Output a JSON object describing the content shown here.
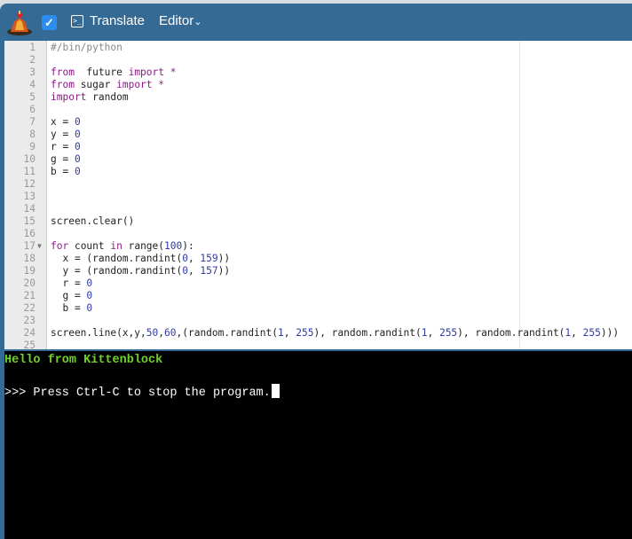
{
  "header": {
    "translate_label": "Translate",
    "editor_label": "Editor",
    "checkbox_checked": true,
    "accent_color": "#356a95"
  },
  "editor": {
    "lines": [
      {
        "n": "1",
        "tokens": [
          [
            "cm",
            "#/bin/python"
          ]
        ]
      },
      {
        "n": "2",
        "tokens": []
      },
      {
        "n": "3",
        "tokens": [
          [
            "kw",
            "from"
          ],
          [
            "",
            "  future "
          ],
          [
            "kw",
            "import"
          ],
          [
            "kw",
            " *"
          ]
        ]
      },
      {
        "n": "4",
        "tokens": [
          [
            "kw",
            "from"
          ],
          [
            "",
            " sugar "
          ],
          [
            "kw",
            "import"
          ],
          [
            "kw",
            " *"
          ]
        ]
      },
      {
        "n": "5",
        "tokens": [
          [
            "kw",
            "import"
          ],
          [
            "",
            " random"
          ]
        ]
      },
      {
        "n": "6",
        "tokens": []
      },
      {
        "n": "7",
        "tokens": [
          [
            "",
            "x = "
          ],
          [
            "num",
            "0"
          ]
        ]
      },
      {
        "n": "8",
        "tokens": [
          [
            "",
            "y = "
          ],
          [
            "num",
            "0"
          ]
        ]
      },
      {
        "n": "9",
        "tokens": [
          [
            "",
            "r = "
          ],
          [
            "num",
            "0"
          ]
        ]
      },
      {
        "n": "10",
        "tokens": [
          [
            "",
            "g = "
          ],
          [
            "num",
            "0"
          ]
        ]
      },
      {
        "n": "11",
        "tokens": [
          [
            "",
            "b = "
          ],
          [
            "num",
            "0"
          ]
        ]
      },
      {
        "n": "12",
        "tokens": []
      },
      {
        "n": "13",
        "tokens": []
      },
      {
        "n": "14",
        "tokens": []
      },
      {
        "n": "15",
        "tokens": [
          [
            "",
            "screen.clear()"
          ]
        ]
      },
      {
        "n": "16",
        "tokens": []
      },
      {
        "n": "17",
        "fold": true,
        "tokens": [
          [
            "kw",
            "for"
          ],
          [
            "",
            " count "
          ],
          [
            "kw",
            "in"
          ],
          [
            "",
            " range("
          ],
          [
            "num",
            "100"
          ],
          [
            "",
            "):"
          ]
        ]
      },
      {
        "n": "18",
        "tokens": [
          [
            "",
            "  x = (random.randint("
          ],
          [
            "num",
            "0"
          ],
          [
            "",
            ", "
          ],
          [
            "num",
            "159"
          ],
          [
            "",
            "))"
          ]
        ]
      },
      {
        "n": "19",
        "tokens": [
          [
            "",
            "  y = (random.randint("
          ],
          [
            "num",
            "0"
          ],
          [
            "",
            ", "
          ],
          [
            "num",
            "157"
          ],
          [
            "",
            "))"
          ]
        ]
      },
      {
        "n": "20",
        "tokens": [
          [
            "",
            "  r = "
          ],
          [
            "num",
            "0"
          ]
        ]
      },
      {
        "n": "21",
        "tokens": [
          [
            "",
            "  g = "
          ],
          [
            "num",
            "0"
          ]
        ]
      },
      {
        "n": "22",
        "tokens": [
          [
            "",
            "  b = "
          ],
          [
            "num",
            "0"
          ]
        ]
      },
      {
        "n": "23",
        "tokens": []
      },
      {
        "n": "24",
        "tokens": [
          [
            "",
            "screen.line(x,y,"
          ],
          [
            "num",
            "50"
          ],
          [
            "",
            ","
          ],
          [
            "num",
            "60"
          ],
          [
            "",
            ",(random.randint("
          ],
          [
            "num",
            "1"
          ],
          [
            "",
            ", "
          ],
          [
            "num",
            "255"
          ],
          [
            "",
            "), random.randint("
          ],
          [
            "num",
            "1"
          ],
          [
            "",
            ", "
          ],
          [
            "num",
            "255"
          ],
          [
            "",
            "), random.randint("
          ],
          [
            "num",
            "1"
          ],
          [
            "",
            ", "
          ],
          [
            "num",
            "255"
          ],
          [
            "",
            ")))"
          ]
        ]
      },
      {
        "n": "25",
        "tokens": []
      }
    ]
  },
  "terminal": {
    "greeting": "Hello from Kittenblock",
    "prompt": ">>> Press Ctrl-C to stop the program."
  }
}
